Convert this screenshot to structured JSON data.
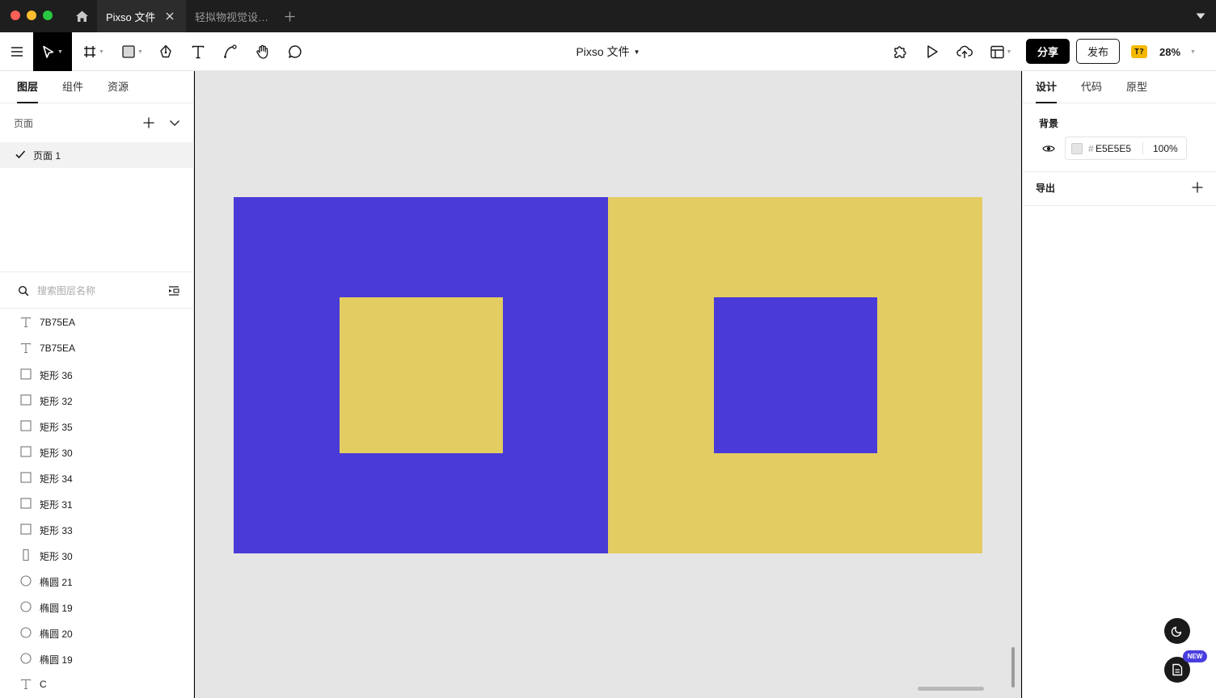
{
  "titlebar": {
    "tabs": [
      {
        "label": "Pixso 文件",
        "active": true
      },
      {
        "label": "轻拟物视觉设…",
        "active": false
      }
    ]
  },
  "toolbar": {
    "doc_title": "Pixso 文件",
    "share_label": "分享",
    "publish_label": "发布",
    "badge_label": "T?",
    "zoom": "28%"
  },
  "left_panel": {
    "tabs": [
      {
        "label": "图层",
        "active": true
      },
      {
        "label": "组件",
        "active": false
      },
      {
        "label": "资源",
        "active": false
      }
    ],
    "pages_label": "页面",
    "pages": [
      {
        "label": "页面 1",
        "selected": true
      }
    ],
    "search_placeholder": "搜索图层名称",
    "layers": [
      {
        "name": "7B75EA",
        "icon": "text-icon"
      },
      {
        "name": "7B75EA",
        "icon": "text-icon"
      },
      {
        "name": "矩形 36",
        "icon": "rectangle-icon"
      },
      {
        "name": "矩形 32",
        "icon": "rectangle-icon"
      },
      {
        "name": "矩形 35",
        "icon": "rectangle-icon"
      },
      {
        "name": "矩形 30",
        "icon": "rectangle-icon"
      },
      {
        "name": "矩形 34",
        "icon": "rectangle-icon"
      },
      {
        "name": "矩形 31",
        "icon": "rectangle-icon"
      },
      {
        "name": "矩形 33",
        "icon": "rectangle-icon"
      },
      {
        "name": "矩形 30",
        "icon": "thin-rectangle-icon"
      },
      {
        "name": "椭圆 21",
        "icon": "ellipse-icon"
      },
      {
        "name": "椭圆 19",
        "icon": "ellipse-icon"
      },
      {
        "name": "椭圆 20",
        "icon": "ellipse-icon"
      },
      {
        "name": "椭圆 19",
        "icon": "ellipse-icon"
      },
      {
        "name": "C",
        "icon": "text-icon"
      }
    ]
  },
  "canvas": {
    "background": "#E5E5E5",
    "blue": "#4A3AD7",
    "yellow": "#E3CC62"
  },
  "right_panel": {
    "tabs": [
      {
        "label": "设计",
        "active": true
      },
      {
        "label": "代码",
        "active": false
      },
      {
        "label": "原型",
        "active": false
      }
    ],
    "background_title": "背景",
    "background_hash": "#",
    "background_hex": "E5E5E5",
    "background_opacity": "100%",
    "export_title": "导出",
    "new_badge": "NEW"
  }
}
